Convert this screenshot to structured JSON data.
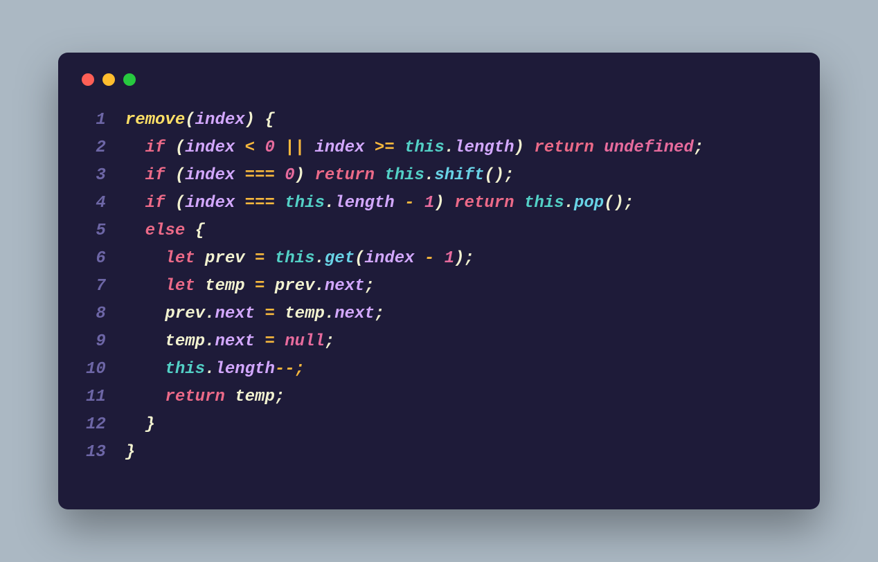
{
  "code": {
    "line_numbers": [
      "1",
      "2",
      "3",
      "4",
      "5",
      "6",
      "7",
      "8",
      "9",
      "10",
      "11",
      "12",
      "13"
    ],
    "l1": {
      "fn": "remove",
      "open": "(",
      "param": "index",
      "close": ") {"
    },
    "l2": {
      "indent": "  ",
      "kw": "if",
      "open": " (",
      "p1": "index",
      "op1": " < ",
      "n0": "0",
      "or": " || ",
      "p2": "index",
      "op2": " >= ",
      "obj": "this",
      "dot": ".",
      "prop": "length",
      "close": ") ",
      "ret": "return",
      "sp": " ",
      "undef": "undefined",
      "semi": ";"
    },
    "l3": {
      "indent": "  ",
      "kw": "if",
      "open": " (",
      "p": "index",
      "eq": " === ",
      "n": "0",
      "close": ") ",
      "ret": "return",
      "sp": " ",
      "obj": "this",
      "dot": ".",
      "meth": "shift",
      "call": "();"
    },
    "l4": {
      "indent": "  ",
      "kw": "if",
      "open": " (",
      "p": "index",
      "eq": " === ",
      "obj": "this",
      "dot": ".",
      "prop": "length",
      "minus": " - ",
      "n": "1",
      "close": ") ",
      "ret": "return",
      "sp": " ",
      "obj2": "this",
      "dot2": ".",
      "meth": "pop",
      "call": "();"
    },
    "l5": {
      "indent": "  ",
      "kw": "else",
      "open": " {"
    },
    "l6": {
      "indent": "    ",
      "kw": "let",
      "sp": " ",
      "v": "prev",
      "eq": " = ",
      "obj": "this",
      "dot": ".",
      "meth": "get",
      "open": "(",
      "p": "index",
      "minus": " - ",
      "n": "1",
      "close": ");"
    },
    "l7": {
      "indent": "    ",
      "kw": "let",
      "sp": " ",
      "v": "temp",
      "eq": " = ",
      "p": "prev",
      "dot": ".",
      "prop": "next",
      "semi": ";"
    },
    "l8": {
      "indent": "    ",
      "p1": "prev",
      "dot1": ".",
      "prop1": "next",
      "eq": " = ",
      "p2": "temp",
      "dot2": ".",
      "prop2": "next",
      "semi": ";"
    },
    "l9": {
      "indent": "    ",
      "p": "temp",
      "dot": ".",
      "prop": "next",
      "eq": " = ",
      "null": "null",
      "semi": ";"
    },
    "l10": {
      "indent": "    ",
      "obj": "this",
      "dot": ".",
      "prop": "length",
      "dec": "--;"
    },
    "l11": {
      "indent": "    ",
      "kw": "return",
      "sp": " ",
      "v": "temp",
      "semi": ";"
    },
    "l12": {
      "indent": "  ",
      "close": "}"
    },
    "l13": {
      "close": "}"
    }
  }
}
